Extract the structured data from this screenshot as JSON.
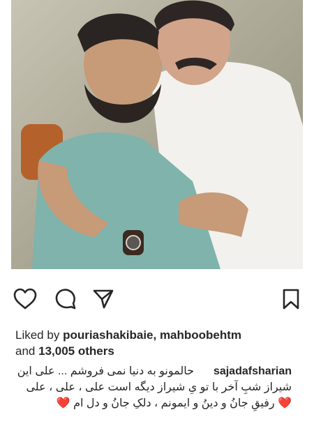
{
  "post": {
    "photo_alt": "two men embracing",
    "actions": {
      "like": "heart-icon",
      "comment": "comment-icon",
      "share": "send-icon",
      "save": "bookmark-icon"
    },
    "likes": {
      "prefix": "Liked by",
      "users": "pouriashakibaie, mahboobehtm",
      "and": "and",
      "others": "13,005 others"
    },
    "caption": {
      "username": "sajadafsharian",
      "line1": "حالمونو به دنیا نمی فروشم ... علی این",
      "line2": "شیراز شبِ آخر با تو یِ شیراز دیگه است علی ، علی ، علی",
      "line3": "❤️ رفیقِ جانُ و دینُ و ایمونم ، دلکِ جانُ و دل ام ❤️"
    }
  }
}
